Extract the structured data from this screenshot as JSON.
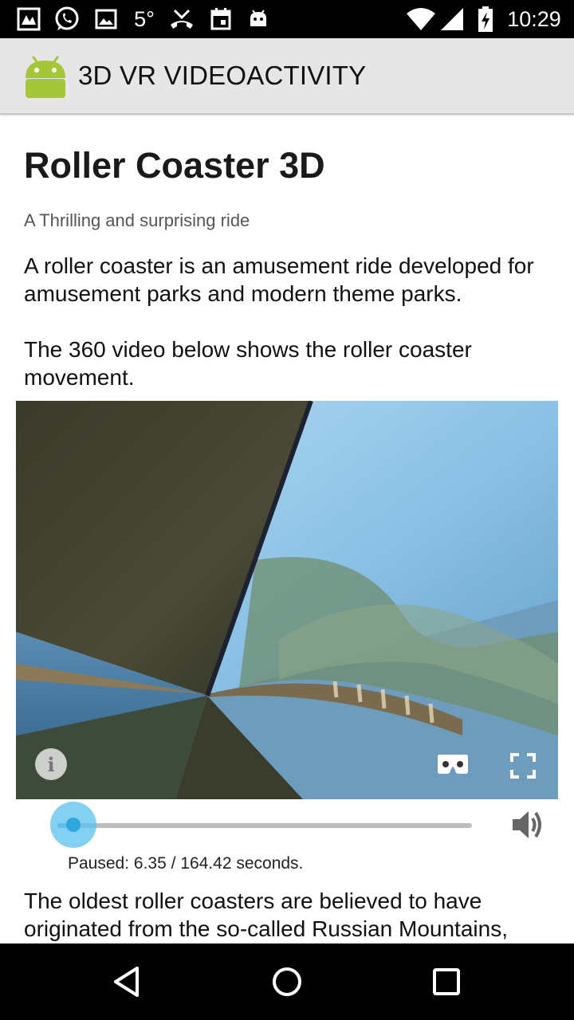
{
  "status_bar": {
    "temperature": "5°",
    "time": "10:29",
    "icons": [
      "notification-icon",
      "whatsapp-icon",
      "gallery-icon",
      "temperature",
      "missed-call-icon",
      "calendar-icon",
      "android-debug-icon",
      "wifi-icon",
      "signal-icon",
      "battery-charging-icon"
    ]
  },
  "action_bar": {
    "title": "3D VR VIDEOACTIVITY",
    "logo_icon": "android-logo-icon",
    "logo_color": "#a4c639"
  },
  "article": {
    "title": "Roller Coaster 3D",
    "subtitle": "A Thrilling and surprising ride",
    "paragraph_1": "A roller coaster is an amusement ride developed for amusement parks and modern theme parks.",
    "paragraph_2": "The 360 video below shows the roller coaster movement.",
    "paragraph_3": "The oldest roller coasters are believed to have originated from the so-called Russian Mountains,"
  },
  "video": {
    "buttons": [
      "info-icon",
      "cardboard-vr-icon",
      "fullscreen-icon"
    ],
    "info_glyph": "i",
    "progress_fraction": 0.0386,
    "status_text": "Paused: 6.35 / 164.42 seconds.",
    "volume_icon": "volume-icon",
    "accent_color": "#5bc0ee"
  },
  "nav_bar": {
    "buttons": [
      "back-icon",
      "home-icon",
      "recent-apps-icon"
    ]
  }
}
